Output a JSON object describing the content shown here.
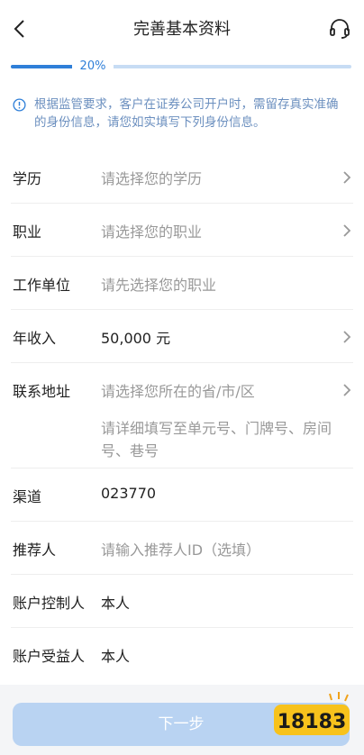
{
  "header": {
    "title": "完善基本资料",
    "back_icon": "chevron-left-icon",
    "service_icon": "headset-icon"
  },
  "progress": {
    "label": "20%",
    "value": 0.2
  },
  "notice": {
    "text": "根据监管要求，客户在证券公司开户时，需留存真实准确的身份信息，请您如实填写下列身份信息。"
  },
  "form": {
    "education": {
      "label": "学历",
      "placeholder": "请选择您的学历"
    },
    "occupation": {
      "label": "职业",
      "placeholder": "请选择您的职业"
    },
    "employer": {
      "label": "工作单位",
      "placeholder": "请先选择您的职业"
    },
    "income": {
      "label": "年收入",
      "value": "50,000 元"
    },
    "address": {
      "label": "联系地址",
      "placeholder": "请选择您所在的省/市/区",
      "detail_placeholder": "请详细填写至单元号、门牌号、房间号、巷号"
    },
    "channel": {
      "label": "渠道",
      "value": "023770"
    },
    "referrer": {
      "label": "推荐人",
      "placeholder": "请输入推荐人ID（选填）"
    },
    "controller": {
      "label": "账户控制人",
      "value": "本人"
    },
    "beneficiary": {
      "label": "账户受益人",
      "value": "本人"
    }
  },
  "footer": {
    "next_label": "下一步"
  },
  "colors": {
    "accent": "#2f7fd8",
    "track": "#c7dcf4",
    "notice_text": "#6b8fbf",
    "button_disabled": "#b9d3f2"
  }
}
